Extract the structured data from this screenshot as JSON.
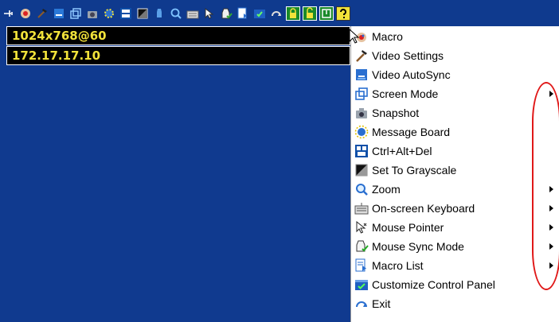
{
  "desktop": {
    "background": "#103a8f"
  },
  "info": {
    "resolution": "1024x768@60",
    "ip": "172.17.17.10",
    "text_color": "#f2e33a"
  },
  "toolbar": {
    "icons": [
      "pin-icon",
      "macro-icon",
      "video-settings-icon",
      "video-autosync-icon",
      "screen-mode-icon",
      "snapshot-icon",
      "message-board-icon",
      "ctrl-alt-del-icon",
      "grayscale-icon",
      "mouse-sync-icon",
      "zoom-icon",
      "keyboard-icon",
      "mouse-pointer-icon",
      "mouse-sync-mode-icon",
      "macro-list-icon",
      "customize-panel-icon",
      "exit-icon",
      "lock-icon",
      "unlock-icon",
      "power-icon",
      "help-icon"
    ]
  },
  "menu": {
    "items": [
      {
        "label": "Macro",
        "icon": "macro-icon",
        "submenu": false
      },
      {
        "label": "Video Settings",
        "icon": "hammer-icon",
        "submenu": false
      },
      {
        "label": "Video AutoSync",
        "icon": "autosync-icon",
        "submenu": false
      },
      {
        "label": "Screen Mode",
        "icon": "screen-mode-icon",
        "submenu": true
      },
      {
        "label": "Snapshot",
        "icon": "camera-icon",
        "submenu": false
      },
      {
        "label": "Message Board",
        "icon": "message-board-icon",
        "submenu": false
      },
      {
        "label": "Ctrl+Alt+Del",
        "icon": "ctrl-alt-del-icon",
        "submenu": false
      },
      {
        "label": "Set To Grayscale",
        "icon": "grayscale-icon",
        "submenu": false
      },
      {
        "label": "Zoom",
        "icon": "zoom-icon",
        "submenu": true
      },
      {
        "label": "On-screen Keyboard",
        "icon": "keyboard-icon",
        "submenu": true
      },
      {
        "label": "Mouse Pointer",
        "icon": "mouse-pointer-icon",
        "submenu": true
      },
      {
        "label": "Mouse Sync Mode",
        "icon": "mouse-sync-icon",
        "submenu": true
      },
      {
        "label": "Macro List",
        "icon": "macro-list-icon",
        "submenu": true
      },
      {
        "label": "Customize Control Panel",
        "icon": "customize-panel-icon",
        "submenu": false
      },
      {
        "label": "Exit",
        "icon": "exit-icon",
        "submenu": false
      }
    ]
  },
  "annotation": {
    "color": "#e01818"
  }
}
